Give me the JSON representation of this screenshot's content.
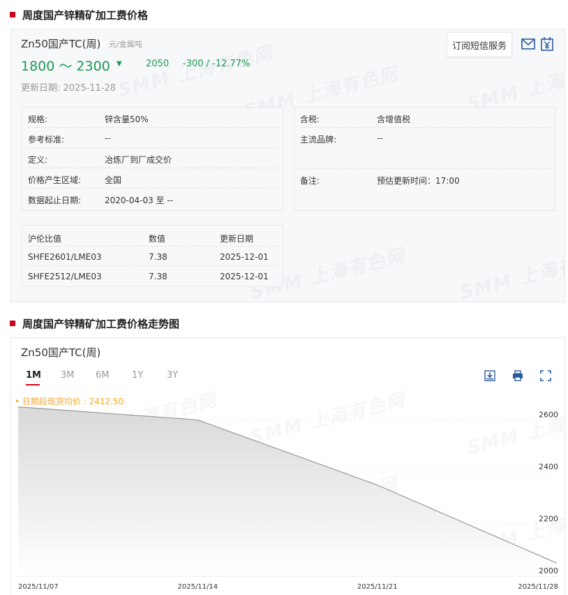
{
  "section1": {
    "title": "周度国产锌精矿加工费价格"
  },
  "product": {
    "name": "Zn50国产TC(周)",
    "unit": "元/金属吨",
    "price_range": "1800 ～ 2300",
    "prev_avg": "2050",
    "change": "-300 / -12.77%",
    "update_date": "更新日期:  2025-11-28",
    "subscribe_label": "订阅短信服务"
  },
  "icons": {
    "mail": "mail-icon",
    "calendar": "yen-calendar-icon",
    "download": "download-icon",
    "print": "print-icon",
    "fullscreen": "fullscreen-icon"
  },
  "colors": {
    "accent": "#d0021b",
    "down": "#1a9a52",
    "avg": "#f5a623"
  },
  "spec_left": [
    {
      "k": "规格:",
      "v": "锌含量50%"
    },
    {
      "k": "参考标准:",
      "v": "--"
    },
    {
      "k": "定义:",
      "v": "冶炼厂到厂成交价"
    },
    {
      "k": "价格产生区域:",
      "v": "全国"
    },
    {
      "k": "数据起止日期:",
      "v": "2020-04-03 至 --"
    }
  ],
  "spec_right": [
    {
      "k": "含税:",
      "v": "含增值税"
    },
    {
      "k": "主流品牌:",
      "v": "--"
    },
    {
      "k": "备注:",
      "v": "预估更新时间：17:00"
    }
  ],
  "ratio_table": {
    "headers": [
      "沪伦比值",
      "数值",
      "更新日期"
    ],
    "rows": [
      [
        "SHFE2601/LME03",
        "7.38",
        "2025-12-01"
      ],
      [
        "SHFE2512/LME03",
        "7.38",
        "2025-12-01"
      ]
    ]
  },
  "section2": {
    "title": "周度国产锌精矿加工费价格走势图"
  },
  "chart_panel": {
    "title": "Zn50国产TC(周)",
    "tabs": [
      "1M",
      "3M",
      "6M",
      "1Y",
      "3Y"
    ],
    "active_tab": "1M",
    "avg_label": "• 日期段现货均价 : 2412.50"
  },
  "watermark": "SMM 上海有色网",
  "chart_data": {
    "type": "area",
    "x": [
      "2025/11/07",
      "2025/11/14",
      "2025/11/21",
      "2025/11/28"
    ],
    "values": [
      2650,
      2600,
      2350,
      2050
    ],
    "ylim": [
      2000,
      2700
    ],
    "yticks": [
      2000,
      2200,
      2400,
      2600
    ],
    "grid": true,
    "colors": {
      "line": "#999999",
      "fill_top": "#d9d9d9",
      "fill_bottom": "#ffffff"
    }
  }
}
